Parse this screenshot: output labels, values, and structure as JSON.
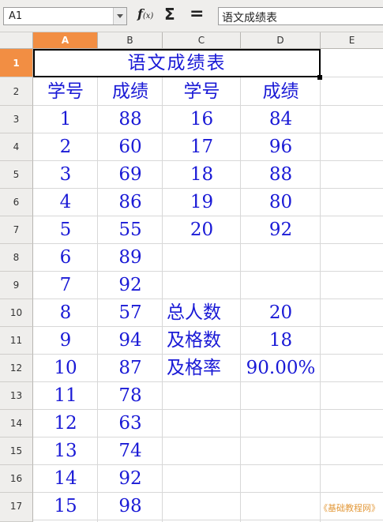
{
  "formula_bar": {
    "name_box": "A1",
    "formula": "语文成绩表"
  },
  "icons": {
    "function_wizard": "function-wizard-icon",
    "sum": "sum-icon",
    "formula": "equals-icon"
  },
  "columns": [
    "A",
    "B",
    "C",
    "D",
    "E"
  ],
  "rows": [
    "1",
    "2",
    "3",
    "4",
    "5",
    "6",
    "7",
    "8",
    "9",
    "10",
    "11",
    "12",
    "13",
    "14",
    "15",
    "16",
    "17"
  ],
  "active_cell": {
    "column": "A",
    "row": "1"
  },
  "colors": {
    "cell_text": "#1a1ad6",
    "active_header": "#f28e43",
    "watermark": "#e39a3c"
  },
  "sheet": {
    "title": "语文成绩表",
    "headers": {
      "a": "学号",
      "b": "成绩",
      "c": "学号",
      "d": "成绩"
    },
    "left_table": [
      {
        "id": "1",
        "score": "88"
      },
      {
        "id": "2",
        "score": "60"
      },
      {
        "id": "3",
        "score": "69"
      },
      {
        "id": "4",
        "score": "86"
      },
      {
        "id": "5",
        "score": "55"
      },
      {
        "id": "6",
        "score": "89"
      },
      {
        "id": "7",
        "score": "92"
      },
      {
        "id": "8",
        "score": "57"
      },
      {
        "id": "9",
        "score": "94"
      },
      {
        "id": "10",
        "score": "87"
      },
      {
        "id": "11",
        "score": "78"
      },
      {
        "id": "12",
        "score": "63"
      },
      {
        "id": "13",
        "score": "74"
      },
      {
        "id": "14",
        "score": "92"
      },
      {
        "id": "15",
        "score": "98"
      }
    ],
    "right_table": [
      {
        "id": "16",
        "score": "84"
      },
      {
        "id": "17",
        "score": "96"
      },
      {
        "id": "18",
        "score": "88"
      },
      {
        "id": "19",
        "score": "80"
      },
      {
        "id": "20",
        "score": "92"
      }
    ],
    "stats": [
      {
        "label": "总人数",
        "value": "20"
      },
      {
        "label": "及格数",
        "value": "18"
      },
      {
        "label": "及格率",
        "value": "90.00%"
      }
    ]
  },
  "watermark": "《基础教程网》"
}
